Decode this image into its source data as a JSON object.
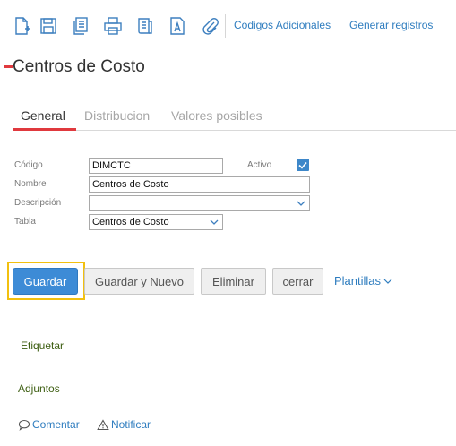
{
  "toolbar": {
    "icons": [
      "new-document-icon",
      "save-icon",
      "copy-icon",
      "print-icon",
      "report-icon",
      "text-document-icon",
      "attachment-icon"
    ],
    "links": [
      "Codigos Adicionales",
      "Generar registros"
    ]
  },
  "page": {
    "title": "Centros de Costo"
  },
  "tabs": [
    {
      "label": "General",
      "active": true
    },
    {
      "label": "Distribucion",
      "active": false
    },
    {
      "label": "Valores posibles",
      "active": false
    }
  ],
  "form": {
    "codigo": {
      "label": "Código",
      "value": "DIMCTC"
    },
    "activo": {
      "label": "Activo",
      "checked": true
    },
    "nombre": {
      "label": "Nombre",
      "value": "Centros de Costo"
    },
    "descripcion": {
      "label": "Descripción",
      "value": ""
    },
    "tabla": {
      "label": "Tabla",
      "value": "Centros de Costo"
    }
  },
  "actions": {
    "guardar": "Guardar",
    "guardar_nuevo": "Guardar y Nuevo",
    "eliminar": "Eliminar",
    "cerrar": "cerrar",
    "plantillas": "Plantillas"
  },
  "sections": {
    "etiquetar": "Etiquetar",
    "adjuntos": "Adjuntos"
  },
  "footer": {
    "comentar": "Comentar",
    "notificar": "Notificar"
  },
  "colors": {
    "accent_red": "#e0393e",
    "link_blue": "#2f7dbf",
    "primary_button": "#3d8bd6",
    "focus_yellow": "#f2c00f",
    "section_green": "#3c5d10"
  }
}
